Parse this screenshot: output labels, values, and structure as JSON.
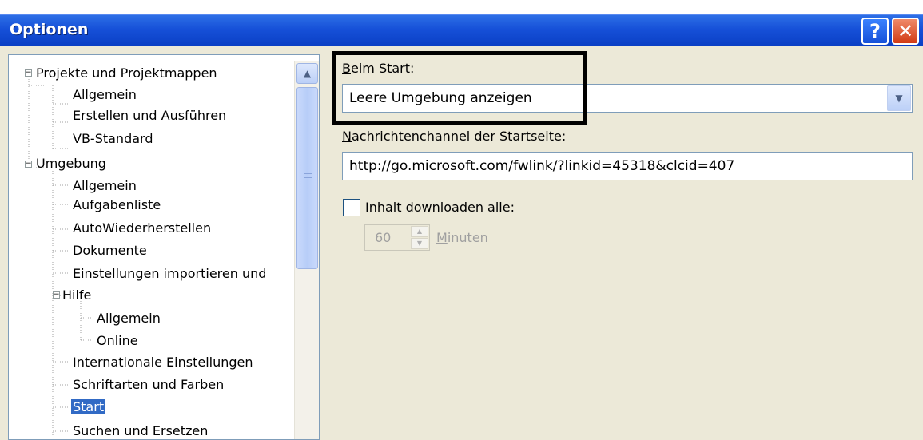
{
  "window": {
    "title": "Optionen",
    "help_label": "?",
    "close_label": "✕"
  },
  "tree": {
    "items": [
      {
        "label": "Projekte und Projektmappen"
      },
      {
        "label": "Allgemein"
      },
      {
        "label": "Erstellen und Ausführen"
      },
      {
        "label": "VB-Standard"
      },
      {
        "label": "Umgebung"
      },
      {
        "label": "Allgemein"
      },
      {
        "label": "Aufgabenliste"
      },
      {
        "label": "AutoWiederherstellen"
      },
      {
        "label": "Dokumente"
      },
      {
        "label": "Einstellungen importieren und"
      },
      {
        "label": "Hilfe"
      },
      {
        "label": "Allgemein"
      },
      {
        "label": "Online"
      },
      {
        "label": "Internationale Einstellungen"
      },
      {
        "label": "Schriftarten und Farben"
      },
      {
        "label": "Start"
      },
      {
        "label": "Suchen und Ersetzen"
      }
    ],
    "selected": "Start",
    "expander_collapse": "−",
    "scroll_up": "▲"
  },
  "startup": {
    "label": "Beim Start:",
    "value": "Leere Umgebung anzeigen",
    "dropdown_icon": "▼"
  },
  "news_channel": {
    "label": "Nachrichtenchannel der Startseite:",
    "value": "http://go.microsoft.com/fwlink/?linkid=45318&clcid=407"
  },
  "download": {
    "label": "Inhalt downloaden alle:",
    "checked": false,
    "interval_value": "60",
    "interval_unit": "Minuten",
    "spin_up": "▲",
    "spin_down": "▼"
  },
  "colors": {
    "title_bar": "#0a3fc4",
    "selection": "#316ac5",
    "highlight_box": "#000000"
  }
}
